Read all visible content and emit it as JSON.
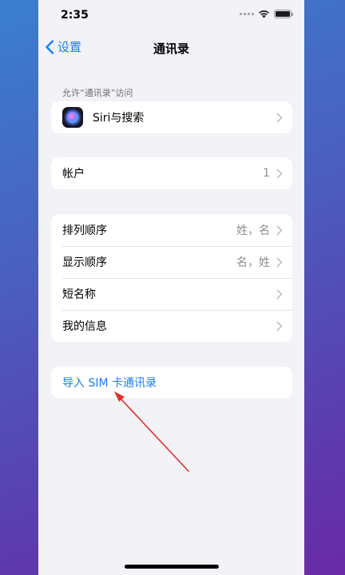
{
  "status_bar": {
    "time": "2:35"
  },
  "nav": {
    "back_label": "设置",
    "title": "通讯录"
  },
  "section_access": {
    "header": "允许“通讯录”访问"
  },
  "rows": {
    "siri": {
      "label": "Siri与搜索"
    },
    "accounts": {
      "label": "帐户",
      "value": "1"
    },
    "sort_order": {
      "label": "排列顺序",
      "value": "姓，名"
    },
    "display_order": {
      "label": "显示顺序",
      "value": "名，姓"
    },
    "short_name": {
      "label": "短名称"
    },
    "my_info": {
      "label": "我的信息"
    },
    "import_sim": {
      "label": "导入 SIM 卡通讯录"
    }
  },
  "colors": {
    "accent": "#1a7cf4",
    "annotation_arrow": "#e0302a"
  }
}
